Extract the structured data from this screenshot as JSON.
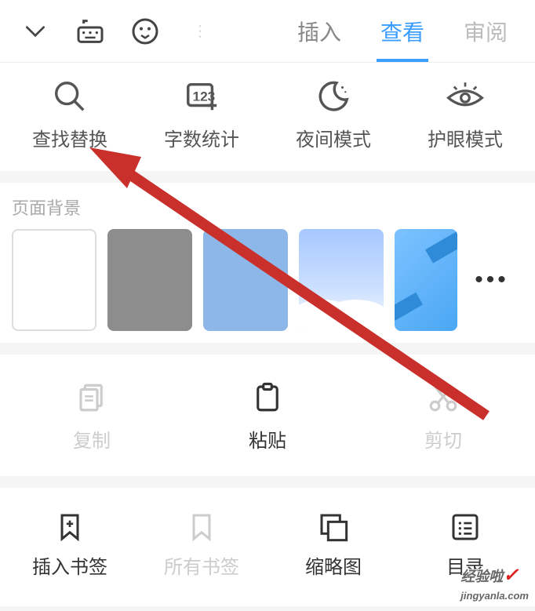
{
  "topbar": {
    "tabs": {
      "insert": "插入",
      "view": "查看",
      "review": "审阅"
    }
  },
  "tools": {
    "find_replace": "查找替换",
    "word_count": "字数统计",
    "night_mode": "夜间模式",
    "eye_mode": "护眼模式"
  },
  "bg_section": {
    "title": "页面背景"
  },
  "actions": {
    "copy": "复制",
    "paste": "粘贴",
    "cut": "剪切"
  },
  "bottom": {
    "insert_bookmark": "插入书签",
    "all_bookmarks": "所有书签",
    "thumbnails": "缩略图",
    "outline": "目录"
  },
  "watermark": {
    "text": "经验啦",
    "url": "jingyanla.com"
  }
}
